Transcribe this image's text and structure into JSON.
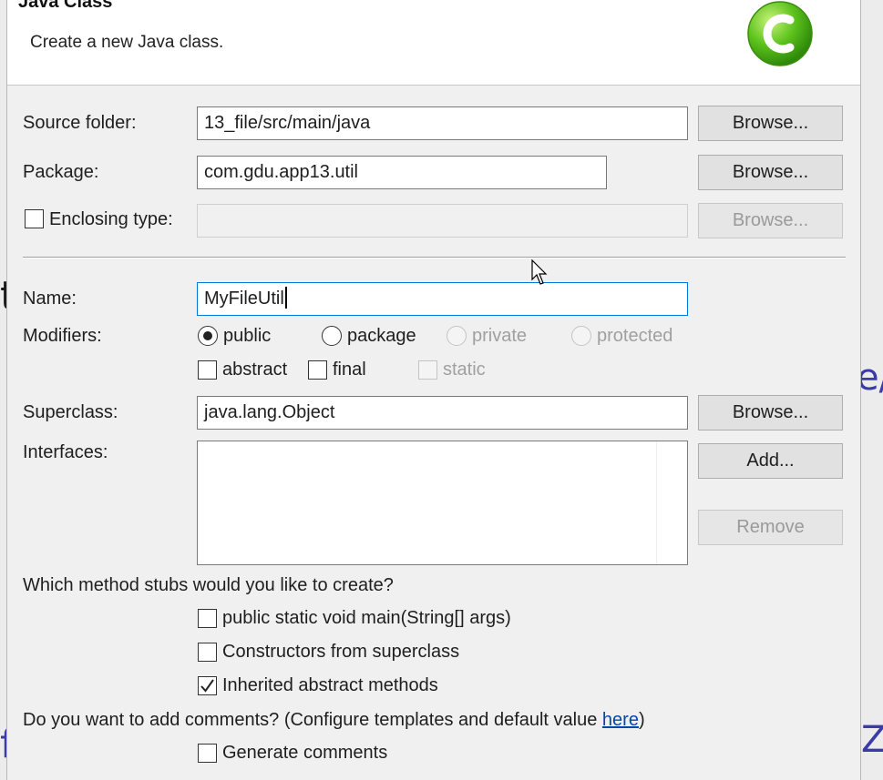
{
  "dialog": {
    "title": "Java Class",
    "description": "Create a new Java class.",
    "icon": "java-class-c-icon"
  },
  "form": {
    "source_folder": {
      "label": "Source folder:",
      "value": "13_file/src/main/java",
      "browse": "Browse..."
    },
    "package": {
      "label": "Package:",
      "value": "com.gdu.app13.util",
      "browse": "Browse..."
    },
    "enclosing_type": {
      "label": "Enclosing type:",
      "checked": false,
      "value": "",
      "browse": "Browse..."
    },
    "name": {
      "label": "Name:",
      "value": "MyFileUtil"
    },
    "modifiers": {
      "label": "Modifiers:",
      "access": [
        {
          "label": "public",
          "selected": true,
          "enabled": true
        },
        {
          "label": "package",
          "selected": false,
          "enabled": true
        },
        {
          "label": "private",
          "selected": false,
          "enabled": false
        },
        {
          "label": "protected",
          "selected": false,
          "enabled": false
        }
      ],
      "flags": [
        {
          "label": "abstract",
          "checked": false,
          "enabled": true
        },
        {
          "label": "final",
          "checked": false,
          "enabled": true
        },
        {
          "label": "static",
          "checked": false,
          "enabled": false
        }
      ]
    },
    "superclass": {
      "label": "Superclass:",
      "value": "java.lang.Object",
      "browse": "Browse..."
    },
    "interfaces": {
      "label": "Interfaces:",
      "add": "Add...",
      "remove": "Remove",
      "items": []
    }
  },
  "stubs": {
    "question": "Which method stubs would you like to create?",
    "options": [
      {
        "label": "public static void main(String[] args)",
        "checked": false
      },
      {
        "label": "Constructors from superclass",
        "checked": false
      },
      {
        "label": "Inherited abstract methods",
        "checked": true
      }
    ]
  },
  "comments": {
    "question_prefix": "Do you want to add comments? (Configure templates and default value ",
    "link_text": "here",
    "question_suffix": ")",
    "option": {
      "label": "Generate comments",
      "checked": false
    }
  },
  "background": {
    "letter_t": "t",
    "letter_e": "e/",
    "letter_f": "f",
    "letter_z": "Z"
  },
  "colors": {
    "focus": "#0078d7",
    "link": "#0645ad",
    "icon_green": "#5cc21c"
  }
}
